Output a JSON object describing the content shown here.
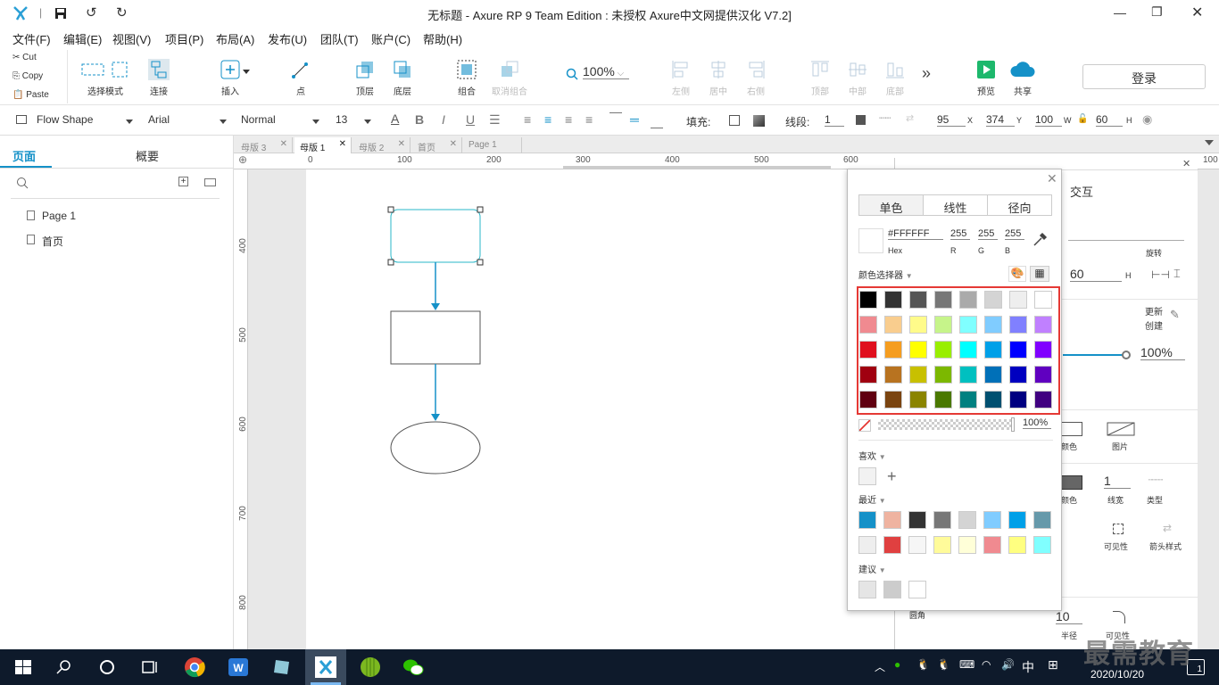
{
  "window": {
    "title": "无标题 - Axure RP 9 Team Edition : 未授权    Axure中文网提供汉化 V7.2]"
  },
  "menu": [
    "文件(F)",
    "编辑(E)",
    "视图(V)",
    "项目(P)",
    "布局(A)",
    "发布(U)",
    "团队(T)",
    "账户(C)",
    "帮助(H)"
  ],
  "clipboard": {
    "cut": "Cut",
    "copy": "Copy",
    "paste": "Paste"
  },
  "toolbar": {
    "select_mode": "选择模式",
    "connect": "连接",
    "insert": "插入",
    "point": "点",
    "top_layer": "顶层",
    "bottom_layer": "底层",
    "group": "组合",
    "ungroup": "取消组合",
    "zoom": "100%",
    "left": "左侧",
    "center": "居中",
    "right": "右侧",
    "top": "顶部",
    "middle": "中部",
    "bottom": "底部",
    "more": "»",
    "preview": "预览",
    "share": "共享",
    "login": "登录"
  },
  "format": {
    "shape": "Flow Shape",
    "font": "Arial",
    "weight": "Normal",
    "size": "13",
    "fill_label": "填充:",
    "line_label": "线段:",
    "line_value": "1",
    "x": "95",
    "x_label": "X",
    "y": "374",
    "y_label": "Y",
    "w": "100",
    "w_label": "W",
    "h": "60",
    "h_label": "H"
  },
  "left_panel": {
    "tab_pages": "页面",
    "tab_outline": "概要",
    "pages": [
      "Page 1",
      "首页"
    ]
  },
  "doc_tabs": [
    "母版 3",
    "母版 1",
    "母版 2",
    "首页",
    "Page 1"
  ],
  "ruler": {
    "h": [
      "0",
      "100",
      "200",
      "300",
      "400",
      "500",
      "600",
      "100"
    ],
    "v": [
      "400",
      "500",
      "600",
      "700",
      "800"
    ]
  },
  "right_panel": {
    "interact": "交互",
    "rotate": "旋转",
    "h_value": "60",
    "h_label": "H",
    "update": "更新",
    "create": "创建",
    "opacity": "100%",
    "color": "颜色",
    "image": "图片",
    "line_color": "颜色",
    "line_width_value": "1",
    "line_width": "线宽",
    "type": "类型",
    "visibility": "可见性",
    "arrow_style": "箭头样式",
    "corner": "圆角",
    "radius_value": "10",
    "radius": "半径",
    "corner_visibility": "可见性"
  },
  "picker": {
    "tab_solid": "单色",
    "tab_linear": "线性",
    "tab_radial": "径向",
    "hex": "#FFFFFF",
    "hex_label": "Hex",
    "r": "255",
    "g": "255",
    "b": "255",
    "r_label": "R",
    "g_label": "G",
    "b_label": "B",
    "section_picker": "颜色选择器",
    "opacity": "100%",
    "favorites": "喜欢",
    "recent": "最近",
    "suggest": "建议",
    "highlight_color": "#e53935",
    "grid": [
      [
        "#000000",
        "#333333",
        "#555555",
        "#777777",
        "#aaaaaa",
        "#d4d4d4",
        "#eeeeee",
        "#ffffff"
      ],
      [
        "#f08a90",
        "#f9cd8e",
        "#fffb8a",
        "#c6f48a",
        "#80ffff",
        "#80ccff",
        "#8080ff",
        "#c080ff"
      ],
      [
        "#e0101e",
        "#f59d20",
        "#ffff00",
        "#99ee00",
        "#00ffff",
        "#00a0e8",
        "#0000ff",
        "#8000ff"
      ],
      [
        "#a00010",
        "#b87320",
        "#c8c000",
        "#7cb800",
        "#00c0c0",
        "#0070b8",
        "#0000c0",
        "#6000c0"
      ],
      [
        "#600010",
        "#7a4410",
        "#8a8400",
        "#4a7800",
        "#008080",
        "#005070",
        "#000080",
        "#400080"
      ]
    ],
    "recent_colors": [
      [
        "#1591c8",
        "#efb3a0",
        "#333333",
        "#777777",
        "#d4d4d4",
        "#80ccff",
        "#00a0e8",
        "#6699aa"
      ],
      [
        "#eeeeee",
        "#e04040",
        "#f6f6f6",
        "#fffb9a",
        "#ffffd8",
        "#f08a90",
        "#ffff80",
        "#80ffff"
      ]
    ],
    "suggest_colors": [
      "#e5e5e5",
      "#cccccc",
      "#ffffff"
    ]
  },
  "taskbar": {
    "ime": "中",
    "date": "2020/10/20",
    "notif": "1"
  },
  "watermark": "最需教育"
}
